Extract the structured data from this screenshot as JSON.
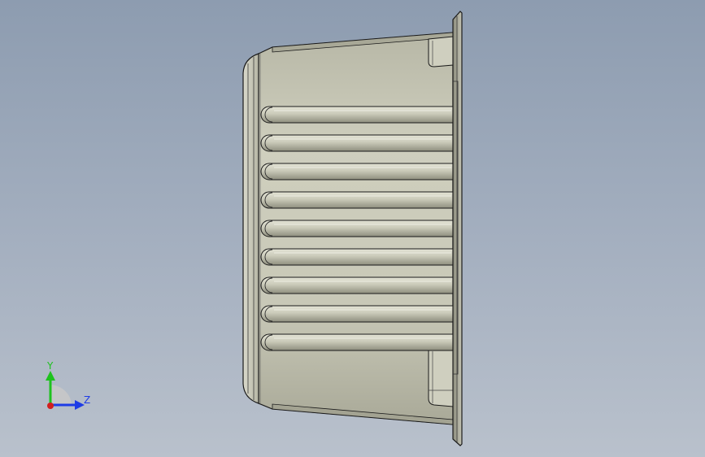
{
  "viewport": {
    "background_top": "#8d9cb0",
    "background_bottom": "#b9c1cc",
    "part": {
      "name": "heatsink-housing",
      "fin_count": 9,
      "body_color": "#c6c6b5",
      "fin_color": "#c9c9b8",
      "edge_color": "#1a1a1a"
    },
    "triad": {
      "y_label": "Y",
      "z_label": "Z",
      "y_color": "#1ec21e",
      "z_color": "#1e3ce6",
      "origin_color": "#d21e1e"
    }
  }
}
